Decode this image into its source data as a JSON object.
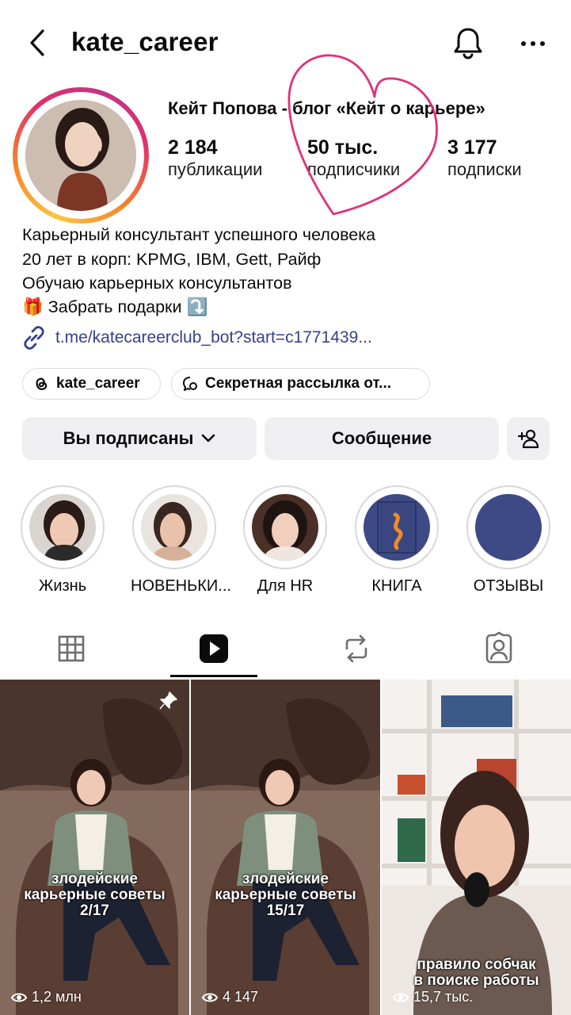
{
  "header": {
    "username": "kate_career"
  },
  "profile": {
    "display_name": "Кейт Попова - блог «Кейт о карьере»",
    "stats": [
      {
        "value": "2 184",
        "label": "публикации"
      },
      {
        "value": "50 тыс.",
        "label": "подписчики"
      },
      {
        "value": "3 177",
        "label": "подписки"
      }
    ],
    "bio": [
      "Карьерный консультант успешного человека",
      "20 лет в корп: KPMG, IBM, Gett, Райф",
      "Обучаю карьерных консультантов",
      "🎁 Забрать подарки ⤵️"
    ],
    "link": "t.me/katecareerclub_bot?start=c1771439..."
  },
  "chips": [
    {
      "icon": "threads-icon",
      "label": "kate_career"
    },
    {
      "icon": "channel-icon",
      "label": "Секретная рассылка от..."
    }
  ],
  "actions": {
    "following_label": "Вы подписаны",
    "message_label": "Сообщение"
  },
  "highlights": [
    {
      "label": "Жизнь"
    },
    {
      "label": "НОВЕНЬКИ..."
    },
    {
      "label": "Для HR"
    },
    {
      "label": "КНИГА"
    },
    {
      "label": "ОТЗЫВЫ"
    }
  ],
  "tabs": [
    "grid-icon",
    "reels-icon",
    "reposts-icon",
    "tagged-icon"
  ],
  "reels": [
    {
      "caption_line1": "злодейские",
      "caption_line2": "карьерные советы",
      "caption_line3": "2/17",
      "views": "1,2 млн",
      "pinned": true
    },
    {
      "caption_line1": "злодейские",
      "caption_line2": "карьерные советы",
      "caption_line3": "15/17",
      "views": "4 147",
      "pinned": false
    },
    {
      "caption_line1": "правило собчак",
      "caption_line2": "в поиске работы",
      "views": "15,7 тыс.",
      "pinned": false
    }
  ],
  "colors": {
    "link": "#36418a",
    "button_bg": "#efeff1",
    "heart": "#e2307a",
    "highlight_blue": "#3d4a86"
  }
}
